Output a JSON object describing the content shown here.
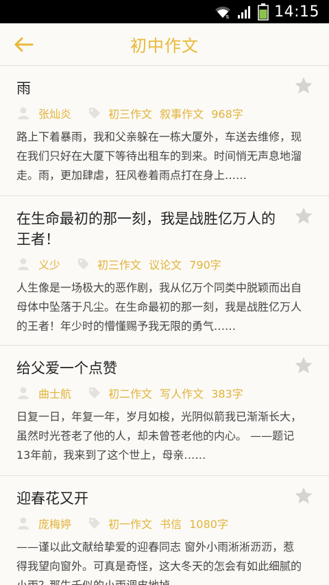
{
  "status_bar": {
    "time": "14:15"
  },
  "header": {
    "title": "初中作文"
  },
  "articles": [
    {
      "title": "雨",
      "author": "张灿炎",
      "grade": "初三作文",
      "genre": "叙事作文",
      "words": "968字",
      "excerpt": "路上下着暴雨，我和父亲躲在一栋大厦外，车送去维修，现在我们只好在大厦下等待出租车的到来。时间悄无声息地溜走。雨，更加肆虐，狂风卷着雨点打在身上……"
    },
    {
      "title": "在生命最初的那一刻，我是战胜亿万人的王者！",
      "author": "义少",
      "grade": "初三作文",
      "genre": "议论文",
      "words": "790字",
      "excerpt": "人生像是一场极大的恶作剧，我从亿万个同类中脱颖而出自母体中坠落于凡尘。在生命最初的那一刻，我是战胜亿万人的王者！年少时的懵懂赐予我无限的勇气……"
    },
    {
      "title": "给父爱一个点赞",
      "author": "曲士航",
      "grade": "初二作文",
      "genre": "写人作文",
      "words": "383字",
      "excerpt": "日复一日，年复一年，岁月如梭，光阴似箭我已渐渐长大，虽然时光苍老了他的人，却未曾苍老他的内心。 ——题记 13年前，我来到了这个世上，母亲……"
    },
    {
      "title": "迎春花又开",
      "author": "庞梅婷",
      "grade": "初一作文",
      "genre": "书信",
      "words": "1080字",
      "excerpt": "——谨以此文献给挚爱的迎春同志 窗外小雨淅淅沥沥，惹得我望向窗外。可真是奇怪，这大冬天的怎会有如此细腻的小雨？那生千似的小雨调皮地掉……"
    }
  ]
}
